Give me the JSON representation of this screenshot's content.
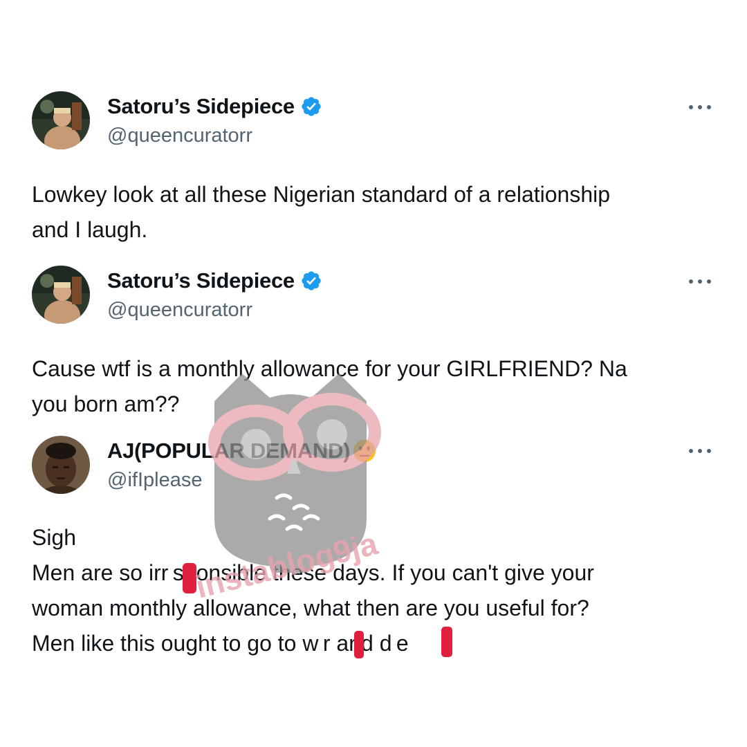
{
  "tweets": [
    {
      "display_name": "Satoru’s Sidepiece",
      "handle": "@queencuratorr",
      "verified": true,
      "avatar_icon": "profile-photo",
      "text_lines": [
        "Lowkey look at all these Nigerian standard of a relationship",
        "and I laugh."
      ]
    },
    {
      "display_name": "Satoru’s Sidepiece",
      "handle": "@queencuratorr",
      "verified": true,
      "avatar_icon": "profile-photo",
      "text_lines": [
        "Cause wtf is a monthly allowance for your GIRLFRIEND? Na",
        "you born am??"
      ]
    },
    {
      "display_name": "AJ(POPULAR DEMAND)",
      "handle": "@ifIplease",
      "verified": false,
      "name_emoji": "neutral-face-emoji",
      "avatar_icon": "profile-photo",
      "text_lines": [
        "Sigh",
        "Men are so irr sponsible these days. If you can't give your",
        "woman monthly allowance, what then are you useful for?",
        "Men like this ought to go to w r and d e"
      ]
    }
  ],
  "watermark": {
    "text": "instablog9ja",
    "icon": "owl-logo"
  },
  "colors": {
    "text": "#0f1419",
    "secondary": "#536471",
    "verified": "#1d9bf0",
    "redaction": "#e0203c",
    "watermark_pink": "#e8a3ad",
    "watermark_gray": "#8e8e8e"
  }
}
